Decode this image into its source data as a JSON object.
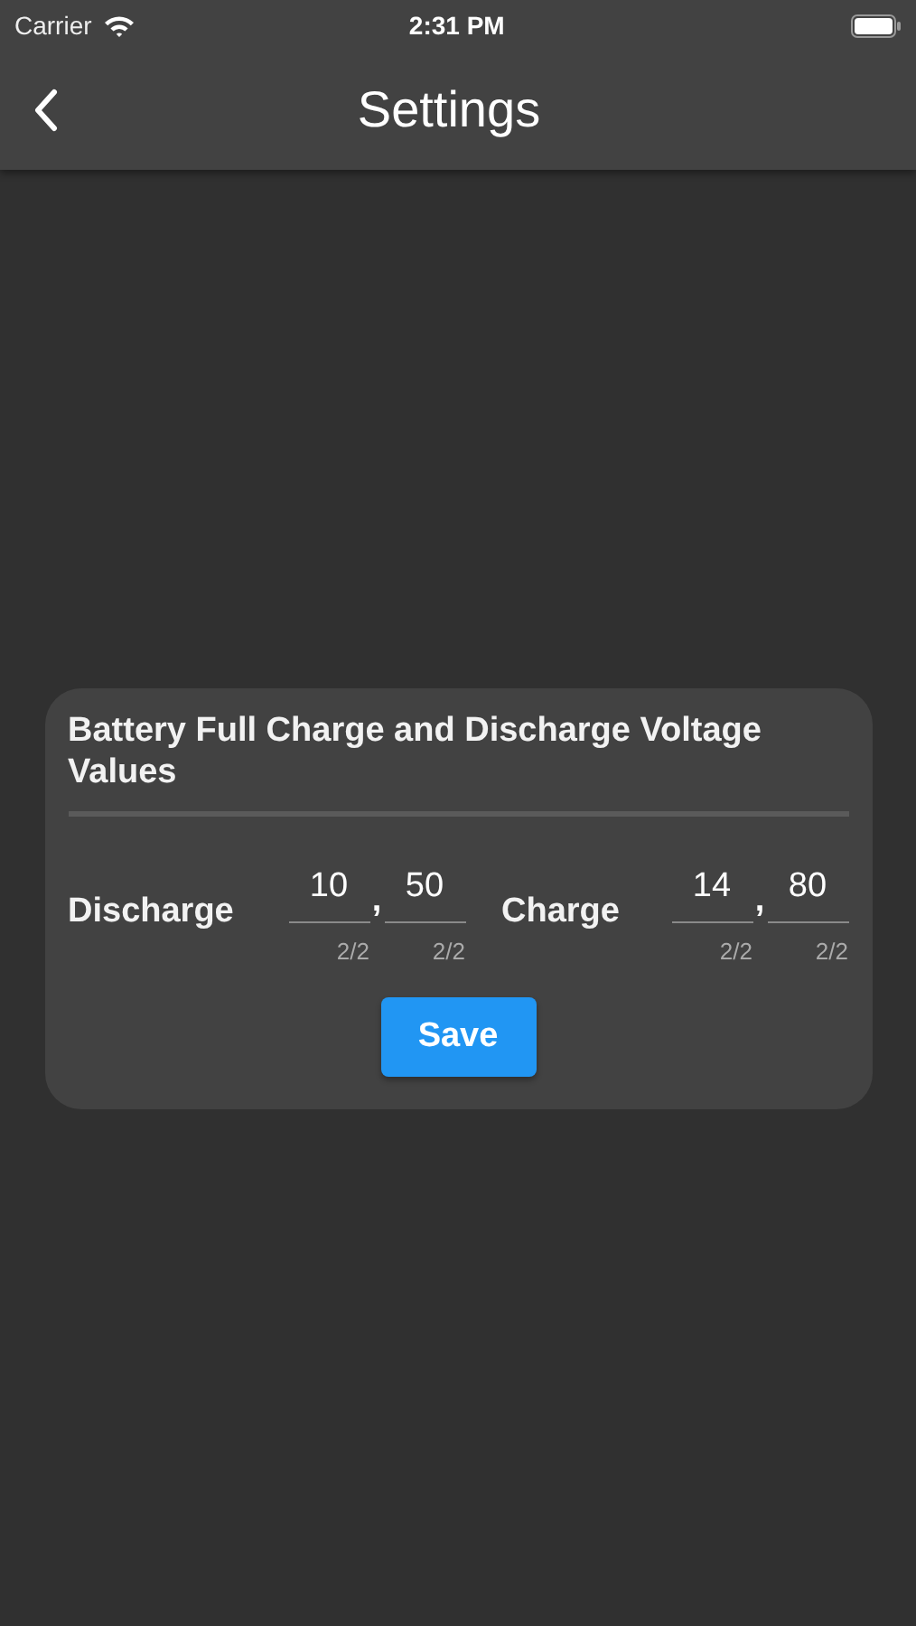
{
  "status_bar": {
    "carrier": "Carrier",
    "time": "2:31 PM"
  },
  "nav": {
    "title": "Settings"
  },
  "card": {
    "title": "Battery Full Charge and Discharge Voltage Values",
    "groups": [
      {
        "label": "Discharge",
        "separator": ",",
        "fields": [
          {
            "value": "10",
            "counter": "2/2"
          },
          {
            "value": "50",
            "counter": "2/2"
          }
        ]
      },
      {
        "label": "Charge",
        "separator": ",",
        "fields": [
          {
            "value": "14",
            "counter": "2/2"
          },
          {
            "value": "80",
            "counter": "2/2"
          }
        ]
      }
    ],
    "button": "Save"
  }
}
